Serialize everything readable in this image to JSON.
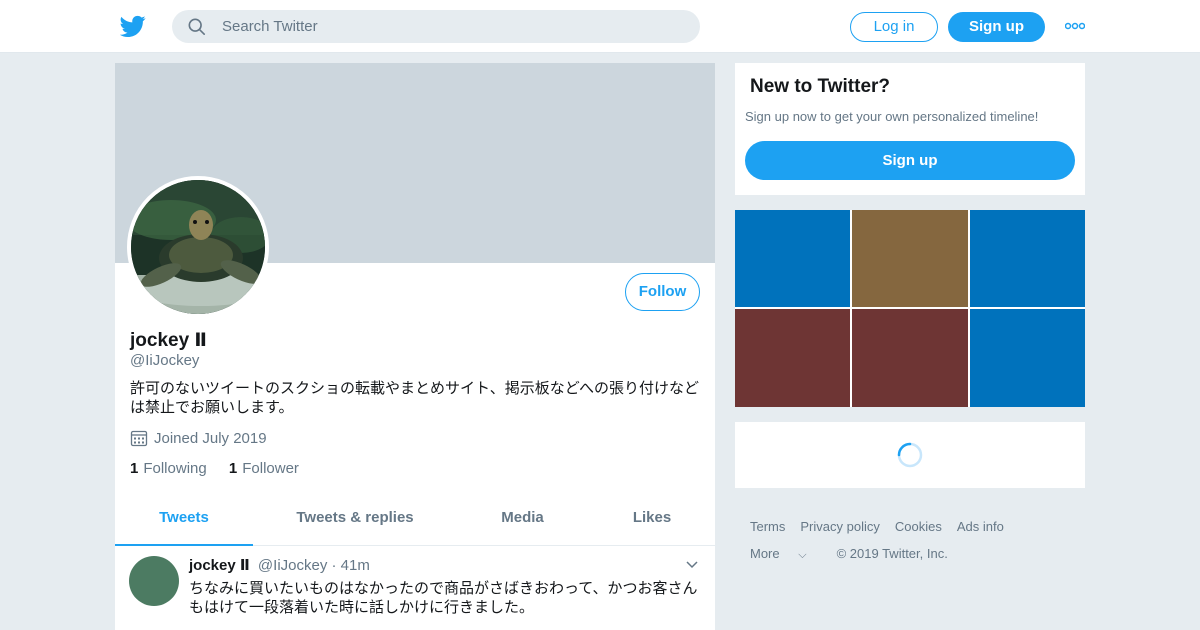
{
  "header": {
    "search_placeholder": "Search Twitter",
    "login_label": "Log in",
    "signup_label": "Sign up"
  },
  "profile": {
    "name": "jockey Ⅱ",
    "handle": "@IiJockey",
    "bio": "許可のないツイートのスクショの転載やまとめサイト、掲示板などへの張り付けなどは禁止でお願いします。",
    "joined": "Joined July 2019",
    "following_count": "1",
    "following_label": "Following",
    "followers_count": "1",
    "followers_label": "Follower",
    "follow_button": "Follow"
  },
  "tabs": [
    {
      "label": "Tweets",
      "active": true
    },
    {
      "label": "Tweets & replies",
      "active": false
    },
    {
      "label": "Media",
      "active": false
    },
    {
      "label": "Likes",
      "active": false
    }
  ],
  "tweet": {
    "name": "jockey Ⅱ",
    "handle": "@IiJockey",
    "time": "· 41m",
    "text": "ちなみに買いたいものはなかったので商品がさばきおわって、かつお客さんもはけて一段落着いた時に話しかけに行きました。"
  },
  "signup_card": {
    "title": "New to Twitter?",
    "subtitle": "Sign up now to get your own personalized timeline!",
    "button": "Sign up"
  },
  "media_colors": [
    "#0072bc",
    "#85673f",
    "#0072bc",
    "#6e3534",
    "#6e3534",
    "#0072bc"
  ],
  "footer": {
    "links": [
      "Terms",
      "Privacy policy",
      "Cookies",
      "Ads info"
    ],
    "more": "More",
    "copyright": "© 2019 Twitter, Inc."
  },
  "colors": {
    "accent": "#1da1f2",
    "background": "#e6ecf0",
    "banner": "#ccd6dd"
  }
}
